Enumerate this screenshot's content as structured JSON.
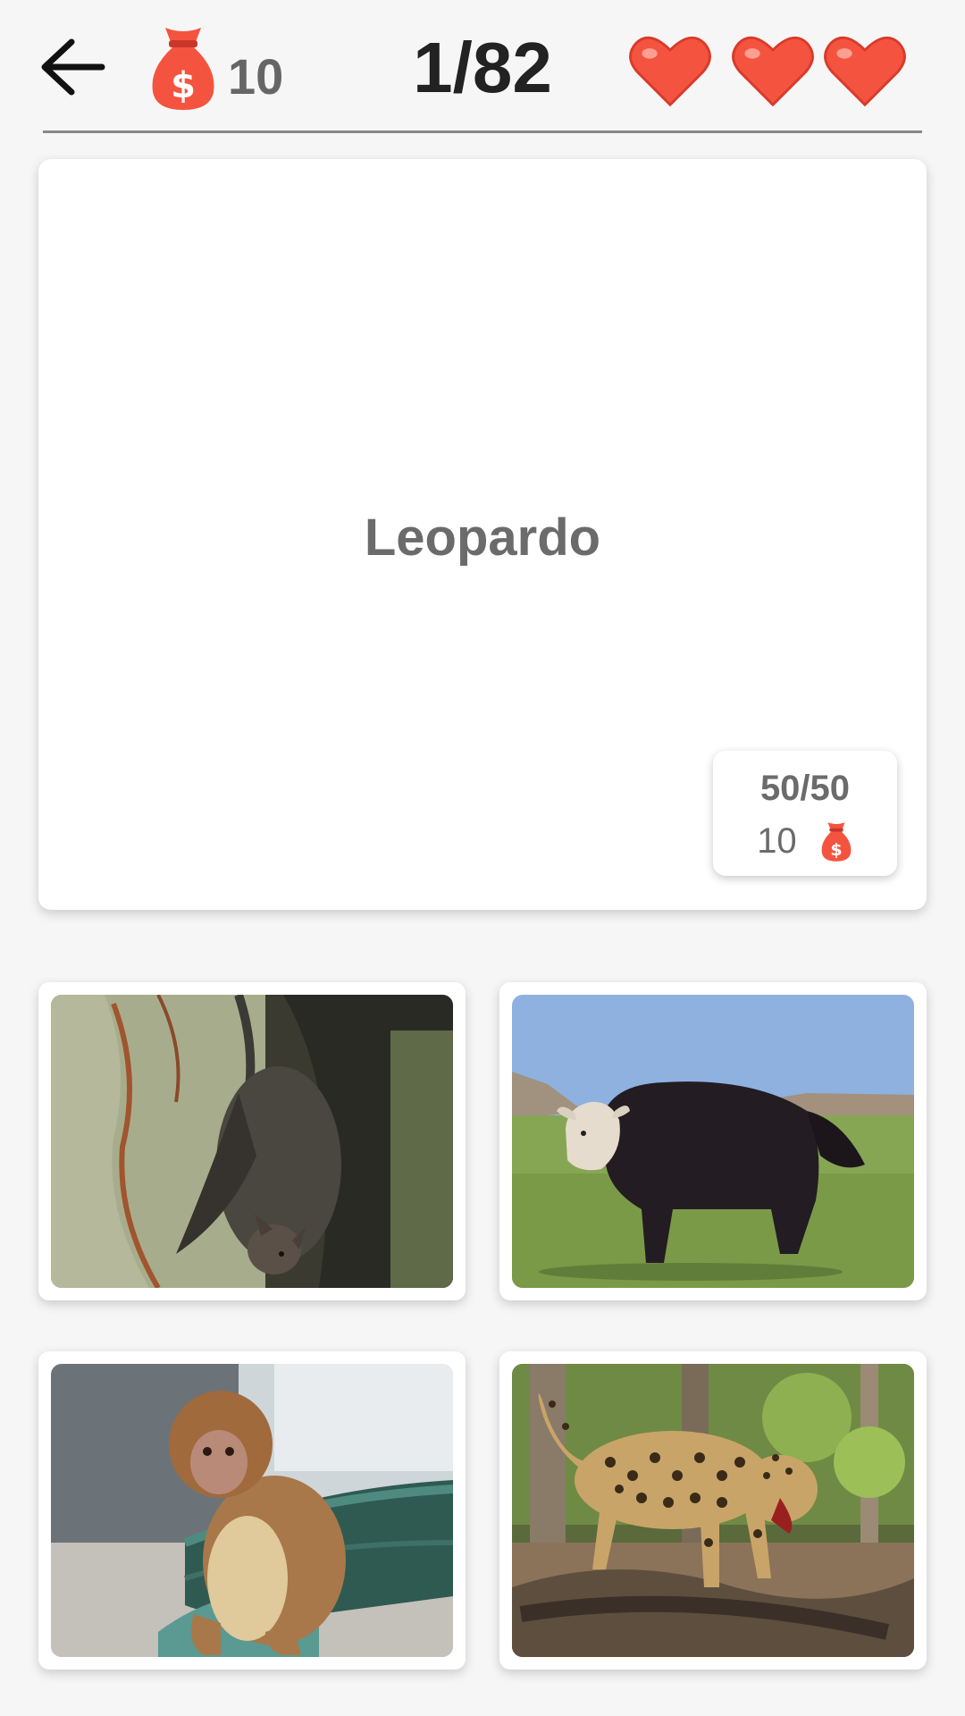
{
  "header": {
    "coins": "10",
    "progress": "1/82",
    "lives_remaining": 3
  },
  "question": {
    "word": "Leopardo"
  },
  "hint": {
    "label": "50/50",
    "cost": "10"
  },
  "options": [
    {
      "animal": "bat"
    },
    {
      "animal": "yak"
    },
    {
      "animal": "macaque"
    },
    {
      "animal": "leopard"
    }
  ],
  "icons": {
    "back": "arrow-left-icon",
    "coins": "money-bag-icon",
    "life": "heart-icon"
  },
  "colors": {
    "heart": "#f4543f",
    "bag": "#f4543f",
    "text_dark": "#222222",
    "text_muted": "#6b6b6b",
    "background": "#f6f6f6"
  }
}
